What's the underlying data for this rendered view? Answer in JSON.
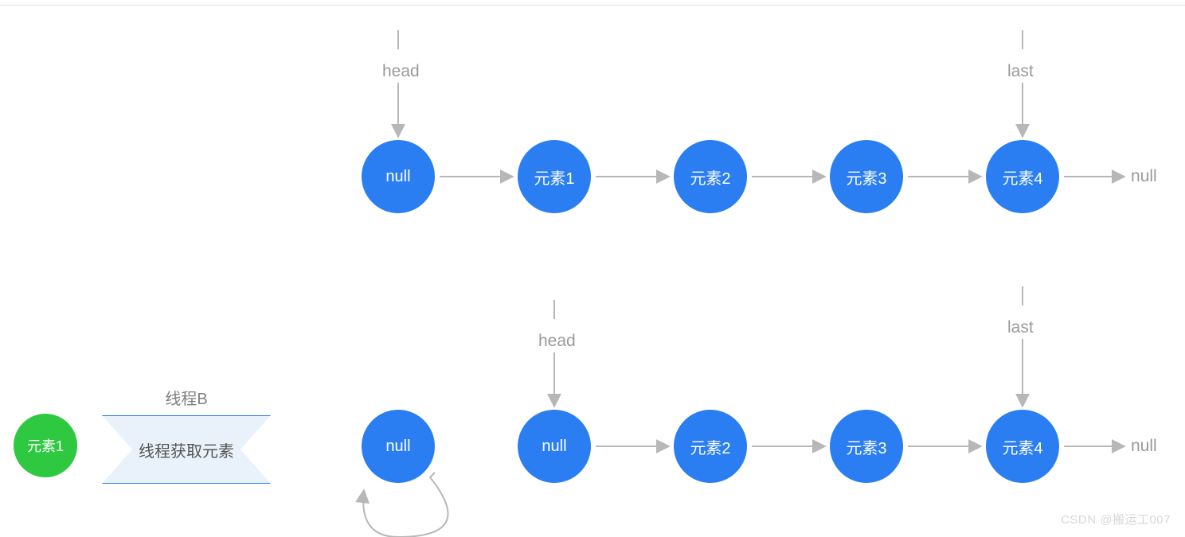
{
  "pointers": {
    "head_top": "head",
    "last_top": "last",
    "head_bottom": "head",
    "last_bottom": "last"
  },
  "row1": {
    "nodes": [
      "null",
      "元素1",
      "元素2",
      "元素3",
      "元素4"
    ],
    "terminal": "null"
  },
  "row2": {
    "nodes": [
      "null",
      "null",
      "元素2",
      "元素3",
      "元素4"
    ],
    "terminal": "null"
  },
  "thread": {
    "title": "线程B",
    "action": "线程获取元素",
    "acquired_node": "元素1"
  },
  "watermark": "CSDN @搬运工007",
  "colors": {
    "blue": "#2a7ef1",
    "green": "#2ec940",
    "arrow": "#b7b7b7"
  }
}
